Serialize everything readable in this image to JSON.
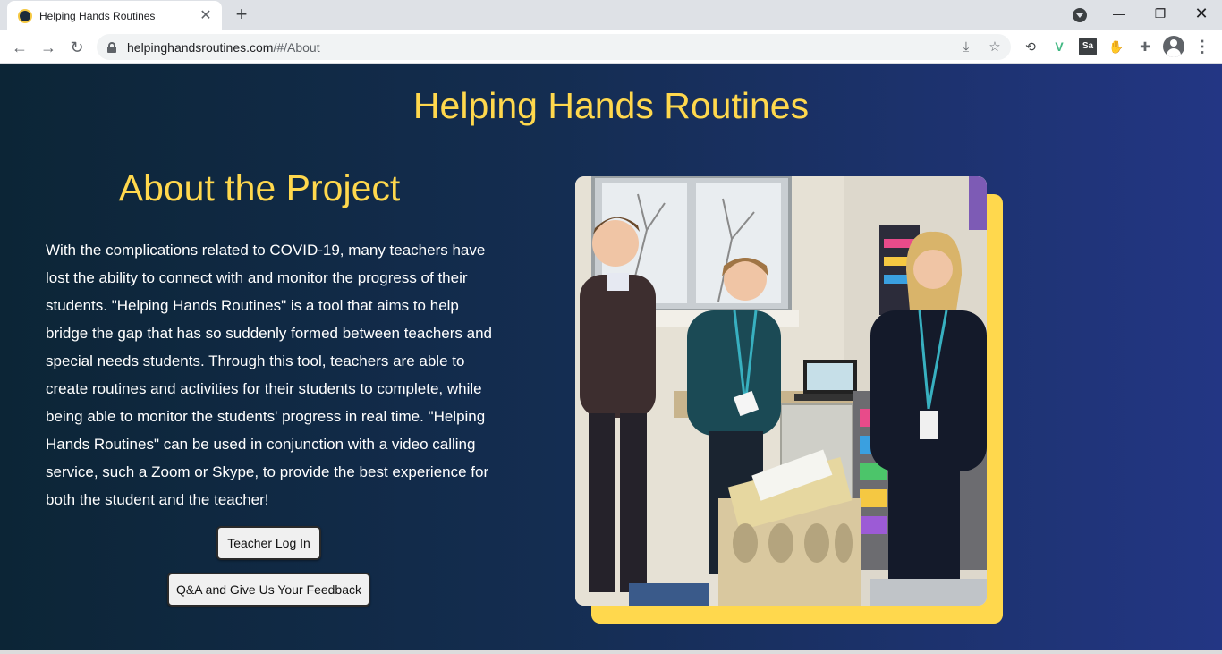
{
  "browser": {
    "tab_title": "Helping Hands Routines",
    "tab_close": "✕",
    "new_tab": "+",
    "url_host": "helpinghandsroutines.com",
    "url_path": "/#/About",
    "window_min": "—",
    "window_max": "❐",
    "window_close": "✕",
    "ext_3_label": "Sa"
  },
  "page": {
    "site_title": "Helping Hands Routines",
    "about_title": "About the Project",
    "about_text": "With the complications related to COVID-19, many teachers have lost the ability to connect with and monitor the progress of their students. \"Helping Hands Routines\" is a tool that aims to help bridge the gap that has so suddenly formed between teachers and special needs students. Through this tool, teachers are able to create routines and activities for their students to complete, while being able to monitor the students' progress in real time. \"Helping Hands Routines\" can be used in conjunction with a video calling service, such a Zoom or Skype, to provide the best experience for both the student and the teacher!",
    "teacher_login_label": "Teacher Log In",
    "feedback_label": "Q&A and Give Us Your Feedback"
  },
  "colors": {
    "accent_yellow": "#ffd84d",
    "bg_left": "#0c2536",
    "bg_right": "#233684"
  }
}
